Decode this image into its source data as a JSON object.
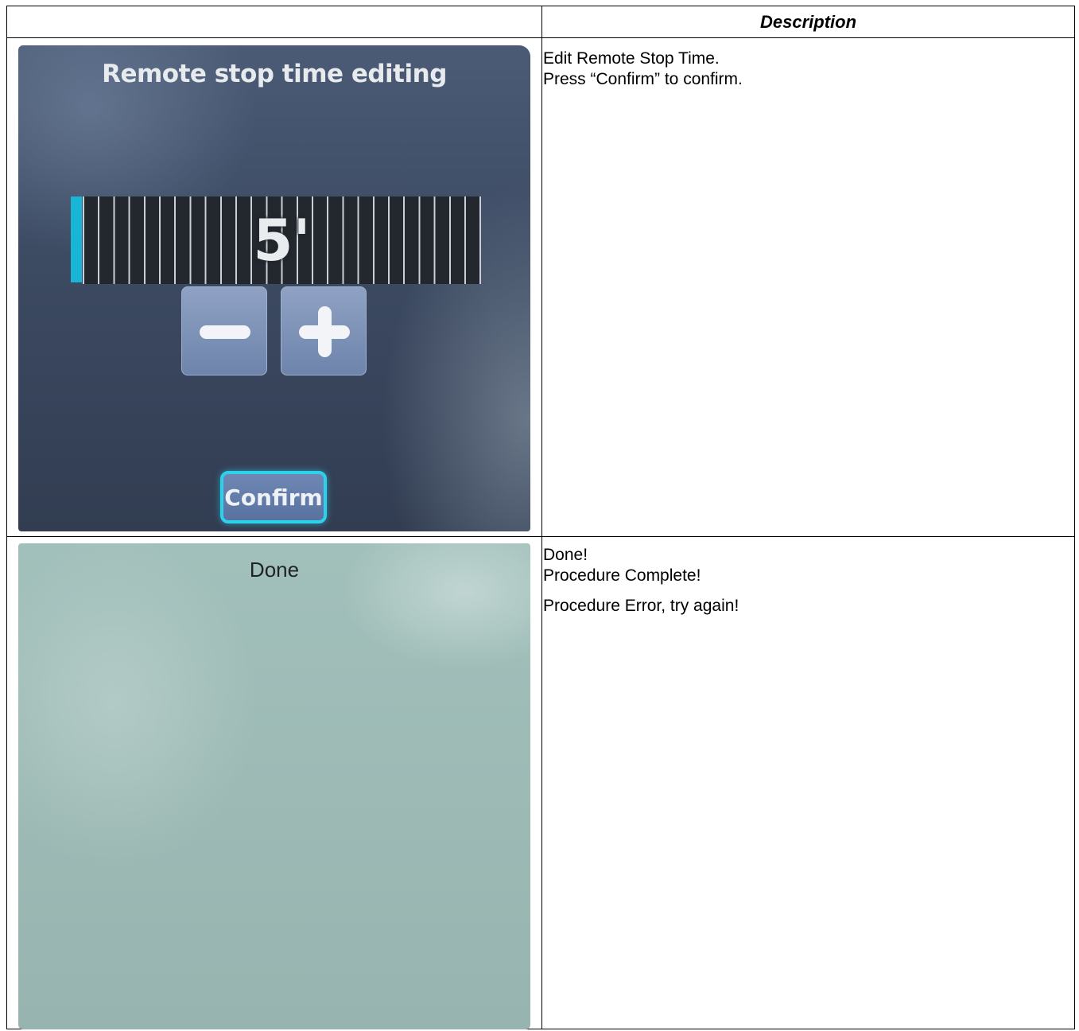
{
  "table": {
    "header": {
      "left": "",
      "right": "Description"
    },
    "rows": [
      {
        "description": [
          "Edit Remote Stop Time.",
          "Press “Confirm” to confirm."
        ],
        "screen": {
          "title": "Remote stop time editing",
          "value": "5'",
          "minus_icon": "minus-icon",
          "plus_icon": "plus-icon",
          "confirm_label": "Confirm",
          "accent": "#18b5d6"
        }
      },
      {
        "description": [
          "Done!",
          "Procedure Complete!",
          "Procedure Error, try again!"
        ],
        "screen": {
          "title": "Done",
          "background": "#9dbab5"
        }
      }
    ]
  }
}
